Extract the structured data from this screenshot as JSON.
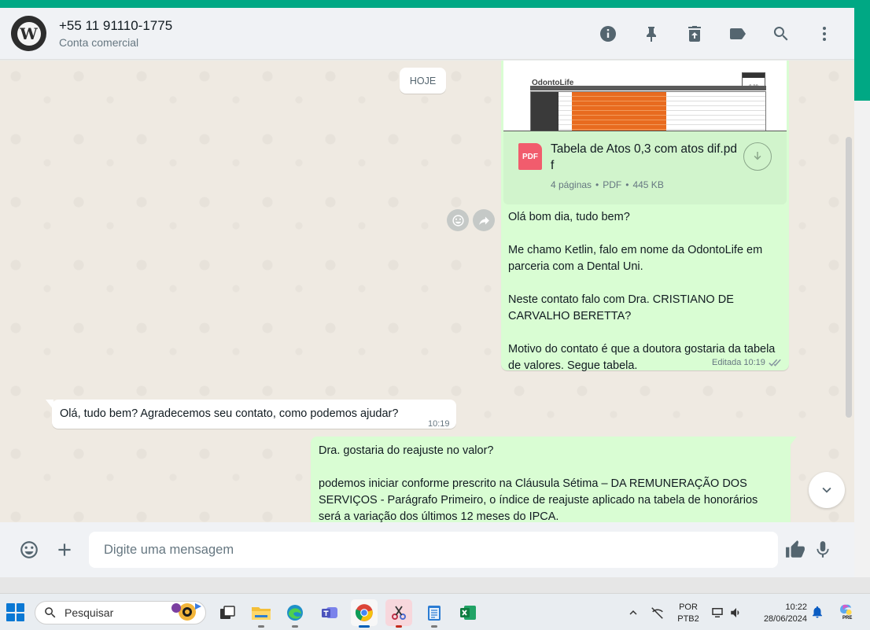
{
  "header": {
    "contact_name": "+55 11 91110-1775",
    "contact_subtitle": "Conta comercial",
    "avatar_letter": "W",
    "icons": [
      "info-icon",
      "pin-icon",
      "delete-icon",
      "label-icon",
      "search-icon",
      "menu-icon"
    ]
  },
  "chat": {
    "date_chip": "HOJE",
    "document": {
      "preview_logo": "OdontoLife",
      "preview_price": "0,30",
      "file_type": "PDF",
      "file_name": "Tabela de Atos 0,3 com atos dif.pdf",
      "pages": "4 páginas",
      "type": "PDF",
      "size": "445 KB"
    },
    "message1": {
      "lines": [
        "Olá bom dia, tudo bem?",
        "",
        "Me chamo Ketlin, falo em nome da OdontoLife em parceria com a Dental Uni.",
        "",
        "Neste contato falo com Dra. CRISTIANO DE CARVALHO BERETTA?",
        "",
        "Motivo do contato é que a doutora gostaria da tabela de valores. Segue tabela."
      ],
      "meta": "Editada 10:19"
    },
    "message2": {
      "text": "Olá, tudo bem? Agradecemos seu contato, como podemos ajudar?",
      "time": "10:19"
    },
    "message3": {
      "lines": [
        "Dra. gostaria do reajuste no valor?",
        "",
        "podemos iniciar conforme prescrito na Cláusula Sétima – DA REMUNERAÇÃO DOS SERVIÇOS - Parágrafo Primeiro, o índice de reajuste aplicado na tabela de honorários será a variação dos últimos 12 meses do IPCA."
      ]
    }
  },
  "composer": {
    "placeholder": "Digite uma mensagem"
  },
  "taskbar": {
    "search_placeholder": "Pesquisar",
    "lang_top": "POR",
    "lang_bottom": "PTB2",
    "time": "10:22",
    "date": "28/06/2024",
    "copilot_badge": "PRE"
  },
  "colors": {
    "accent": "#00a884",
    "outgoing_bubble": "#d9fdd3",
    "incoming_bubble": "#ffffff",
    "chat_bg": "#efeae2"
  }
}
